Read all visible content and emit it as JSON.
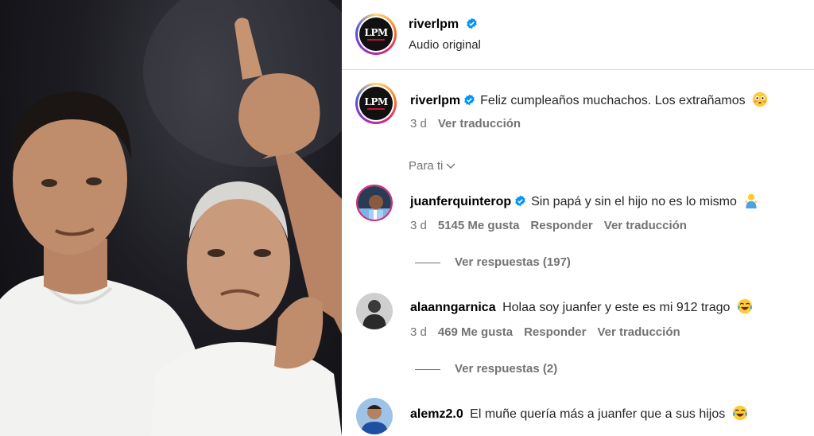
{
  "post": {
    "author": "riverlpm",
    "audio_label": "Audio original",
    "logo_text": "LPM"
  },
  "caption": {
    "username": "riverlpm",
    "text": "Feliz cumpleaños muchachos. Los extrañamos",
    "emoji": "flushed-face",
    "time": "3 d",
    "translate": "Ver traducción"
  },
  "filter": {
    "label": "Para ti"
  },
  "comments": [
    {
      "username": "juanferquinterop",
      "verified": true,
      "text": "Sin papá y sin el hijo no es lo mismo",
      "emoji": "person-shrugging",
      "time": "3 d",
      "likes": "5145 Me gusta",
      "reply": "Responder",
      "translate": "Ver traducción",
      "replies": "Ver respuestas (197)"
    },
    {
      "username": "alaanngarnica",
      "verified": false,
      "text": "Holaa soy juanfer y este es mi 912 trago",
      "emoji": "tears-of-joy",
      "time": "3 d",
      "likes": "469 Me gusta",
      "reply": "Responder",
      "translate": "Ver traducción",
      "replies": "Ver respuestas (2)"
    },
    {
      "username": "alemz2.0",
      "verified": false,
      "text": "El muñe quería más a juanfer que a sus hijos",
      "emoji": "tears-of-joy"
    }
  ],
  "colors": {
    "verified_blue": "#0095f6",
    "muted": "#737373",
    "border": "#dbdbdb"
  }
}
